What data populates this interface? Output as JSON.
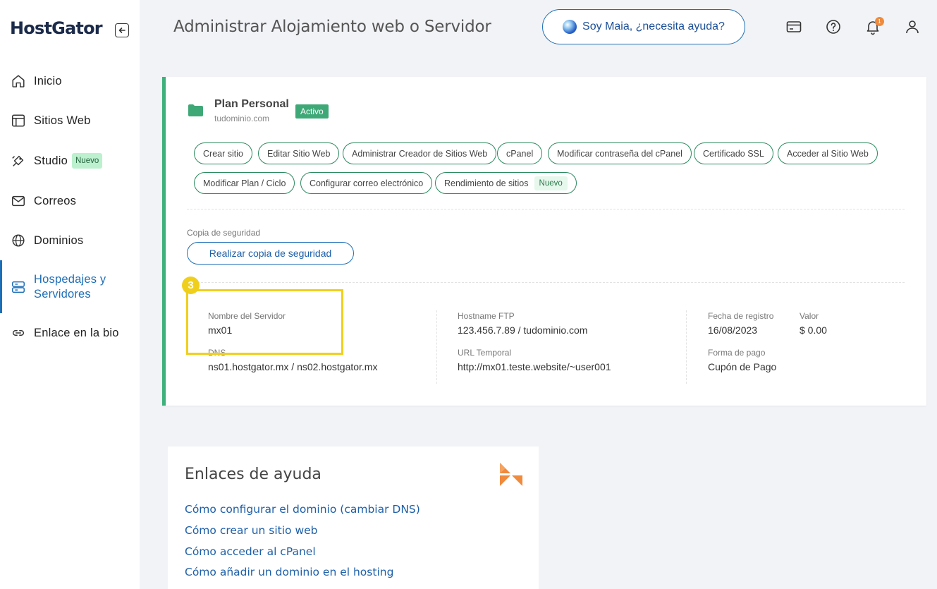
{
  "sidebar": {
    "logo": "HostGator",
    "items": [
      {
        "label": "Inicio",
        "icon": "home-icon"
      },
      {
        "label": "Sitios Web",
        "icon": "layout-icon"
      },
      {
        "label": "Studio",
        "icon": "studio-icon",
        "badge": "Nuevo"
      },
      {
        "label": "Correos",
        "icon": "mail-icon"
      },
      {
        "label": "Dominios",
        "icon": "globe-icon"
      },
      {
        "label": "Hospedajes y Servidores",
        "label_line1": "Hospedajes y",
        "label_line2": "Servidores",
        "icon": "server-icon",
        "active": true
      },
      {
        "label": "Enlace en la bio",
        "icon": "link-icon"
      }
    ]
  },
  "header": {
    "title": "Administrar Alojamiento web o Servidor",
    "assistant_button": "Soy Maia, ¿necesita ayuda?",
    "notification_count": "1",
    "icons": [
      "credit-card-icon",
      "help-icon",
      "bell-icon",
      "user-icon"
    ]
  },
  "plan": {
    "name": "Plan Personal",
    "domain": "tudominio.com",
    "status": "Activo",
    "actions_row1": [
      "Crear sitio",
      "Editar Sitio Web",
      "Administrar Creador de Sitios Web",
      "cPanel",
      "Modificar contraseña del cPanel",
      "Certificado SSL",
      "Acceder al Sitio Web"
    ],
    "actions_row2": [
      "Modificar Plan / Ciclo",
      "Configurar correo electrónico",
      "Rendimiento de sitios"
    ],
    "actions_row2_badge": "Nuevo",
    "backup": {
      "label": "Copia de seguridad",
      "button": "Realizar copia de seguridad"
    },
    "highlight_number": "3",
    "details": {
      "server_name_label": "Nombre del Servidor",
      "server_name": "mx01",
      "dns_label": "DNS",
      "dns": "ns01.hostgator.mx / ns02.hostgator.mx",
      "ftp_label": "Hostname FTP",
      "ftp": "123.456.7.89 / tudominio.com",
      "temp_url_label": "URL Temporal",
      "temp_url": "http://mx01.teste.website/~user001",
      "reg_date_label": "Fecha de registro",
      "reg_date": "16/08/2023",
      "value_label": "Valor",
      "value": "$ 0.00",
      "payment_label": "Forma de pago",
      "payment": "Cupón de Pago"
    }
  },
  "help": {
    "title": "Enlaces de ayuda",
    "links": [
      "Cómo configurar el dominio (cambiar DNS)",
      "Cómo crear un sitio web",
      "Cómo acceder al cPanel",
      "Cómo añadir un dominio en el hosting"
    ]
  },
  "colors": {
    "accent_blue": "#1d6fb8",
    "active_green": "#3db07c",
    "highlight_yellow": "#f0cf1c",
    "brand_orange": "#f08a3c"
  }
}
